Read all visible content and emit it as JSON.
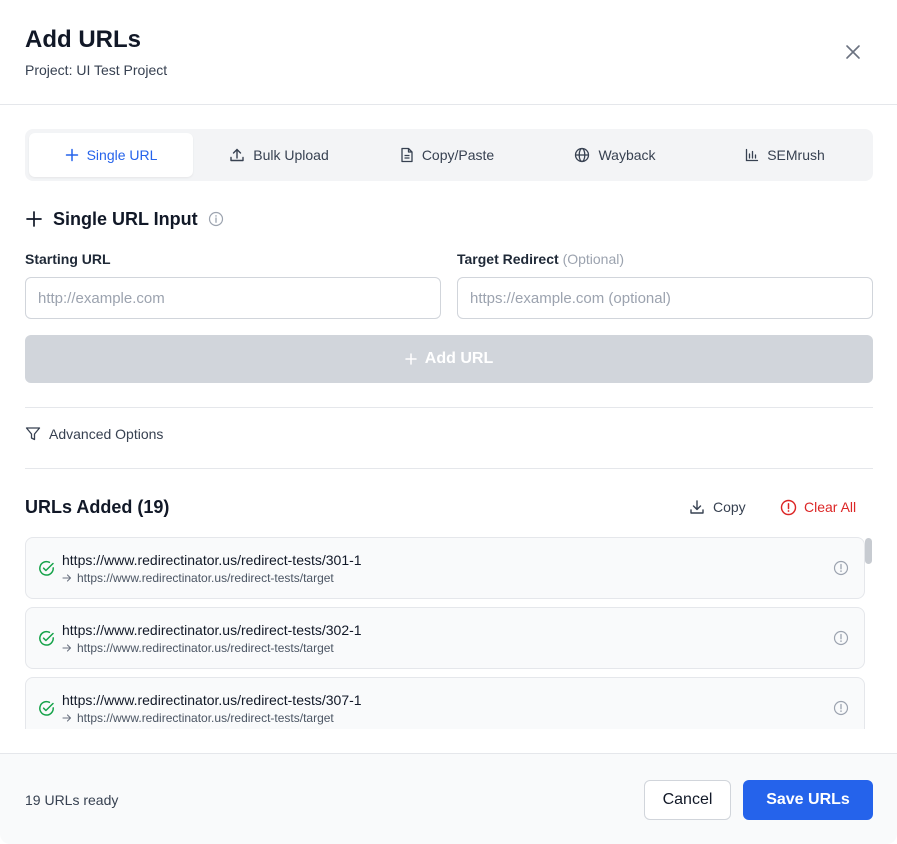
{
  "dialog": {
    "title": "Add URLs",
    "subtitle": "Project: UI Test Project",
    "close_icon": "close-icon"
  },
  "tabs": [
    {
      "label": "Single URL",
      "icon": "plus-icon",
      "active": true
    },
    {
      "label": "Bulk Upload",
      "icon": "upload-icon",
      "active": false
    },
    {
      "label": "Copy/Paste",
      "icon": "document-icon",
      "active": false
    },
    {
      "label": "Wayback",
      "icon": "globe-icon",
      "active": false
    },
    {
      "label": "SEMrush",
      "icon": "bar-chart-icon",
      "active": false
    }
  ],
  "single_input": {
    "title": "Single URL Input",
    "starting_url_label": "Starting URL",
    "starting_url_placeholder": "http://example.com",
    "starting_url_value": "",
    "target_label": "Target Redirect",
    "target_optional": "(Optional)",
    "target_placeholder": "https://example.com (optional)",
    "target_value": "",
    "add_button": "Add URL"
  },
  "advanced": {
    "label": "Advanced Options",
    "icon": "filter-icon"
  },
  "urls": {
    "title": "URLs Added (19)",
    "copy_label": "Copy",
    "clear_label": "Clear All",
    "items": [
      {
        "url": "https://www.redirectinator.us/redirect-tests/301-1",
        "target": "https://www.redirectinator.us/redirect-tests/target"
      },
      {
        "url": "https://www.redirectinator.us/redirect-tests/302-1",
        "target": "https://www.redirectinator.us/redirect-tests/target"
      },
      {
        "url": "https://www.redirectinator.us/redirect-tests/307-1",
        "target": "https://www.redirectinator.us/redirect-tests/target"
      }
    ]
  },
  "footer": {
    "status": "19 URLs ready",
    "cancel_label": "Cancel",
    "save_label": "Save URLs"
  },
  "colors": {
    "accent": "#2563eb",
    "danger": "#dc2626",
    "success": "#16a34a",
    "disabled": "#d1d5db"
  }
}
